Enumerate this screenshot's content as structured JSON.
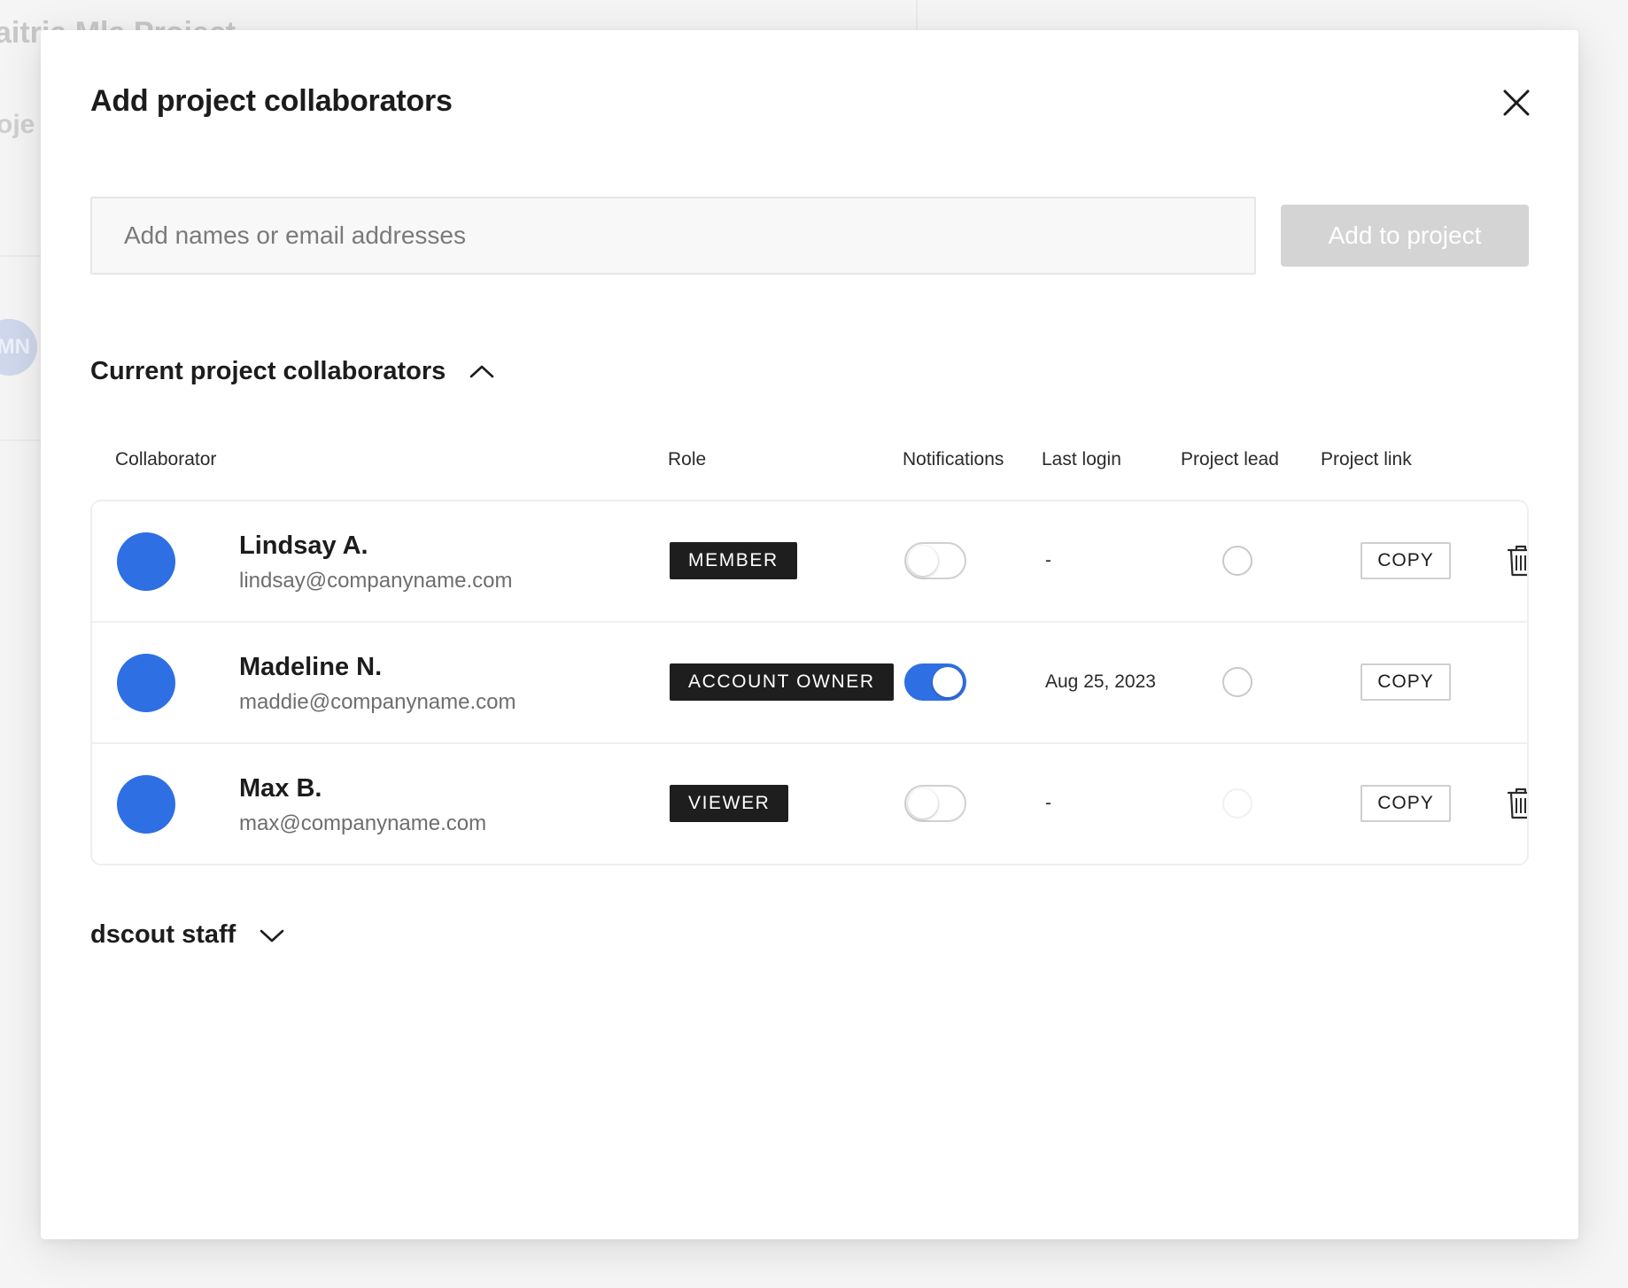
{
  "background": {
    "title_fragment": "aitria Mla Project",
    "sub_fragment": "oje",
    "avatar_initials": "MN"
  },
  "modal": {
    "title": "Add project collaborators",
    "close_icon": "close-icon",
    "search": {
      "placeholder": "Add names or email addresses",
      "value": ""
    },
    "add_button_label": "Add to project",
    "add_button_disabled": true
  },
  "current_section": {
    "title": "Current project collaborators",
    "expanded": true,
    "chevron_icon": "chevron-up-icon"
  },
  "columns": {
    "collaborator": "Collaborator",
    "role": "Role",
    "notifications": "Notifications",
    "last_login": "Last login",
    "project_lead": "Project lead",
    "project_link": "Project link"
  },
  "collaborators": [
    {
      "name": "Lindsay A.",
      "email": "lindsay@companyname.com",
      "role": "MEMBER",
      "notifications_on": false,
      "last_login": "-",
      "project_lead": false,
      "project_lead_disabled": false,
      "copy_label": "COPY",
      "deletable": true
    },
    {
      "name": "Madeline N.",
      "email": "maddie@companyname.com",
      "role": "ACCOUNT OWNER",
      "notifications_on": true,
      "last_login": "Aug 25, 2023",
      "project_lead": false,
      "project_lead_disabled": false,
      "copy_label": "COPY",
      "deletable": false
    },
    {
      "name": "Max B.",
      "email": "max@companyname.com",
      "role": "VIEWER",
      "notifications_on": false,
      "last_login": "-",
      "project_lead": false,
      "project_lead_disabled": true,
      "copy_label": "COPY",
      "deletable": true
    }
  ],
  "staff_section": {
    "title": "dscout staff",
    "expanded": false,
    "chevron_icon": "chevron-down-icon"
  },
  "colors": {
    "accent": "#2f6fe4",
    "badge_bg": "#1e1e1e",
    "disabled_button": "#d4d4d4"
  }
}
